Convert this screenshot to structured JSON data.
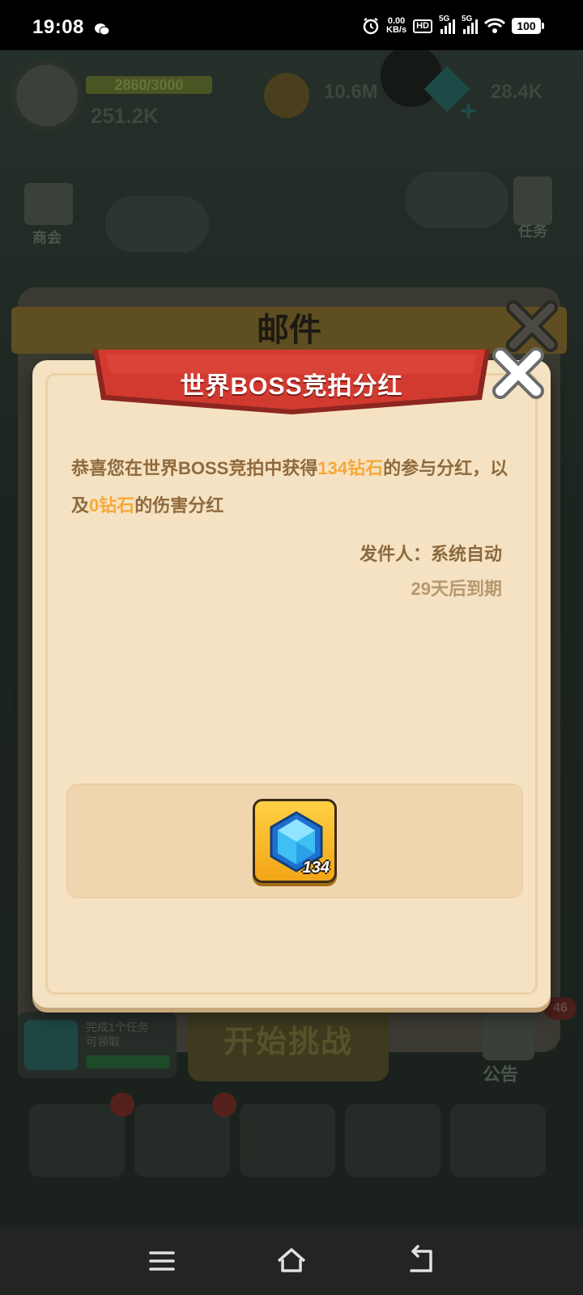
{
  "status_bar": {
    "time": "19:08",
    "net_speed_value": "0.00",
    "net_speed_unit": "KB/s",
    "hd_label": "HD",
    "sim_label_1": "5G",
    "sim_label_2": "5G",
    "battery": "100"
  },
  "background": {
    "exp": "2860/3000",
    "power": "251.2K",
    "coins": "10.6M",
    "gems": "28.4K",
    "shop_label": "商会",
    "task_label": "任务",
    "start_button": "开始挑战",
    "notice_label": "公告",
    "notice_badge": "46",
    "quest_text": "完成1个任务",
    "quest_sub": "可领取"
  },
  "mail_window": {
    "title": "邮件"
  },
  "mail_detail": {
    "title": "世界BOSS竞拍分红",
    "body_prefix": "恭喜您在世界BOSS竞拍中获得",
    "body_amount_1": "134钻石",
    "body_mid": "的参与分红，以及",
    "body_amount_2": "0钻石",
    "body_suffix": "的伤害分红",
    "sender": "发件人：系统自动",
    "expires": "29天后到期",
    "reward": {
      "icon": "diamond-icon",
      "quantity": "134"
    }
  },
  "colors": {
    "highlight": "#f6a93a",
    "body_text": "#8f6a3d",
    "ribbon": "#d23a30",
    "dialog_bg": "#f5e2c2"
  }
}
